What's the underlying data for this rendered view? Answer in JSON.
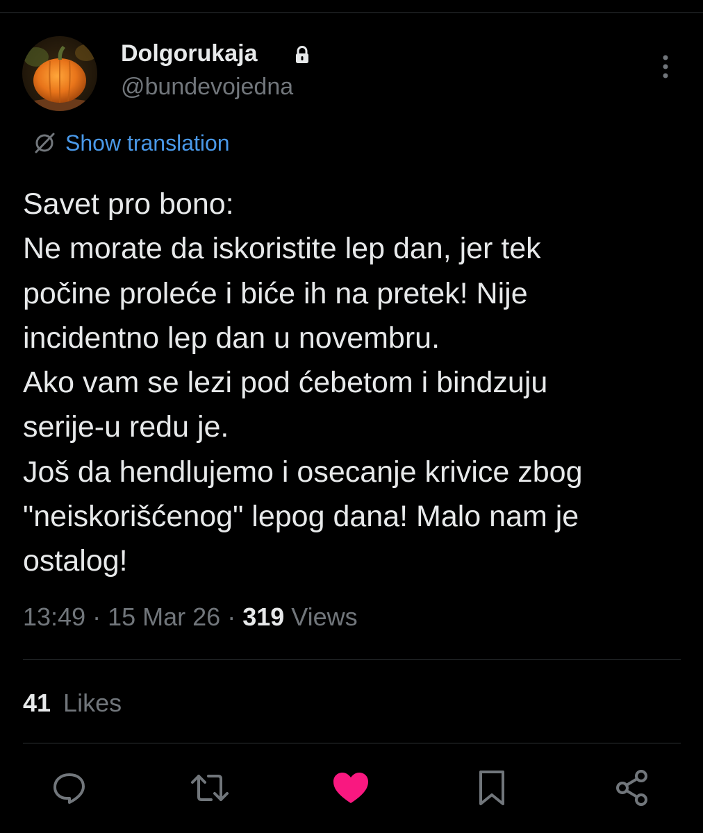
{
  "user": {
    "display_name": "Dolgorukaja",
    "handle": "@bundevojedna",
    "protected_icon": "lock-icon",
    "avatar": "pumpkin-avatar"
  },
  "translation": {
    "label": "Show translation",
    "icon": "translate-icon"
  },
  "tweet": {
    "lines": [
      "Savet pro bono:",
      "Ne morate da iskoristite lep dan, jer tek",
      "počine proleće i biće ih na pretek! Nije",
      "incidentno lep dan u novembru.",
      "Ako vam se lezi pod ćebetom i bindzuju",
      "serije-u redu je.",
      "Još da hendlujemo i osecanje krivice zbog",
      "\"neiskorišćenog\" lepog dana! Malo nam je",
      "ostalog!"
    ]
  },
  "meta": {
    "time": "13:49",
    "separator": " · ",
    "date": "15 Mar 26",
    "views_count": "319",
    "views_label": "Views"
  },
  "stats": {
    "likes_count": "41",
    "likes_label": "Likes"
  },
  "actions": [
    {
      "icon": "reply-icon"
    },
    {
      "icon": "retweet-icon"
    },
    {
      "icon": "heart-icon",
      "active": true
    },
    {
      "icon": "bookmark-icon"
    },
    {
      "icon": "share-icon"
    }
  ],
  "colors": {
    "background": "#000000",
    "text": "#e7e9ea",
    "secondary": "#71767b",
    "link": "#4a99e9",
    "like": "#f91880",
    "divider": "#2f3336"
  }
}
